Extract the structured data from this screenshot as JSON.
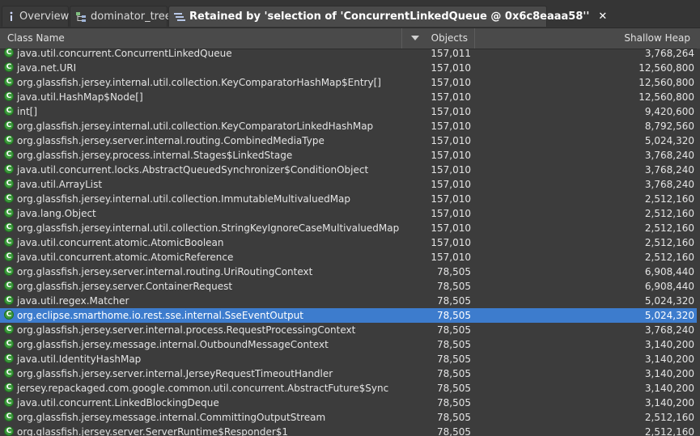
{
  "tabs": [
    {
      "label": "Overview",
      "icon": "info-icon"
    },
    {
      "label": "dominator_tree",
      "icon": "tree-icon"
    },
    {
      "label": "Retained by 'selection of 'ConcurrentLinkedQueue @ 0x6c8eaaa58''",
      "icon": "list-icon",
      "active": true,
      "close": "✕"
    }
  ],
  "columns": {
    "name": "Class Name",
    "objects": "Objects",
    "heap": "Shallow Heap"
  },
  "class_icon_letter": "C",
  "rows": [
    {
      "name": "java.util.concurrent.ConcurrentLinkedQueue",
      "objects": "157,011",
      "heap": "3,768,264"
    },
    {
      "name": "java.net.URI",
      "objects": "157,010",
      "heap": "12,560,800"
    },
    {
      "name": "org.glassfish.jersey.internal.util.collection.KeyComparatorHashMap$Entry[]",
      "objects": "157,010",
      "heap": "12,560,800"
    },
    {
      "name": "java.util.HashMap$Node[]",
      "objects": "157,010",
      "heap": "12,560,800"
    },
    {
      "name": "int[]",
      "objects": "157,010",
      "heap": "9,420,600"
    },
    {
      "name": "org.glassfish.jersey.internal.util.collection.KeyComparatorLinkedHashMap",
      "objects": "157,010",
      "heap": "8,792,560"
    },
    {
      "name": "org.glassfish.jersey.server.internal.routing.CombinedMediaType",
      "objects": "157,010",
      "heap": "5,024,320"
    },
    {
      "name": "org.glassfish.jersey.process.internal.Stages$LinkedStage",
      "objects": "157,010",
      "heap": "3,768,240"
    },
    {
      "name": "java.util.concurrent.locks.AbstractQueuedSynchronizer$ConditionObject",
      "objects": "157,010",
      "heap": "3,768,240"
    },
    {
      "name": "java.util.ArrayList",
      "objects": "157,010",
      "heap": "3,768,240"
    },
    {
      "name": "org.glassfish.jersey.internal.util.collection.ImmutableMultivaluedMap",
      "objects": "157,010",
      "heap": "2,512,160"
    },
    {
      "name": "java.lang.Object",
      "objects": "157,010",
      "heap": "2,512,160"
    },
    {
      "name": "org.glassfish.jersey.internal.util.collection.StringKeyIgnoreCaseMultivaluedMap",
      "objects": "157,010",
      "heap": "2,512,160"
    },
    {
      "name": "java.util.concurrent.atomic.AtomicBoolean",
      "objects": "157,010",
      "heap": "2,512,160"
    },
    {
      "name": "java.util.concurrent.atomic.AtomicReference",
      "objects": "157,010",
      "heap": "2,512,160"
    },
    {
      "name": "org.glassfish.jersey.server.internal.routing.UriRoutingContext",
      "objects": "78,505",
      "heap": "6,908,440"
    },
    {
      "name": "org.glassfish.jersey.server.ContainerRequest",
      "objects": "78,505",
      "heap": "6,908,440"
    },
    {
      "name": "java.util.regex.Matcher",
      "objects": "78,505",
      "heap": "5,024,320"
    },
    {
      "name": "org.eclipse.smarthome.io.rest.sse.internal.SseEventOutput",
      "objects": "78,505",
      "heap": "5,024,320",
      "selected": true
    },
    {
      "name": "org.glassfish.jersey.server.internal.process.RequestProcessingContext",
      "objects": "78,505",
      "heap": "3,768,240"
    },
    {
      "name": "org.glassfish.jersey.message.internal.OutboundMessageContext",
      "objects": "78,505",
      "heap": "3,140,200"
    },
    {
      "name": "java.util.IdentityHashMap",
      "objects": "78,505",
      "heap": "3,140,200"
    },
    {
      "name": "org.glassfish.jersey.server.internal.JerseyRequestTimeoutHandler",
      "objects": "78,505",
      "heap": "3,140,200"
    },
    {
      "name": "jersey.repackaged.com.google.common.util.concurrent.AbstractFuture$Sync",
      "objects": "78,505",
      "heap": "3,140,200"
    },
    {
      "name": "java.util.concurrent.LinkedBlockingDeque",
      "objects": "78,505",
      "heap": "3,140,200"
    },
    {
      "name": "org.glassfish.jersey.message.internal.CommittingOutputStream",
      "objects": "78,505",
      "heap": "2,512,160"
    },
    {
      "name": "org.glassfish.jersey.server.ServerRuntime$Responder$1",
      "objects": "78,505",
      "heap": "2,512,160"
    }
  ]
}
